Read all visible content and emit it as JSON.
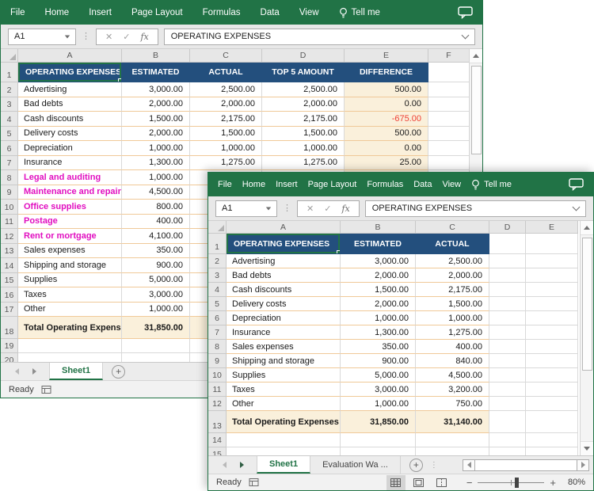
{
  "colors": {
    "ribbon_green": "#217346",
    "header_blue": "#234F7D",
    "total_beige": "#FAF0DB",
    "row_border_tan": "#F0C998",
    "removed_row_magenta": "#E10FC0",
    "negative_red": "#EF3E33",
    "selection_green": "#217346",
    "active_tab_green": "#217346"
  },
  "icons": {
    "tell_me": "lightbulb",
    "ribbon_right": "comment-bubble",
    "name_box_arrow": "chevron-down",
    "formula_buttons": [
      "cancel-x",
      "enter-check",
      "fx"
    ],
    "formula_bar_right": "chevron-down",
    "status_left": "macro-record",
    "view_modes": [
      "normal-grid-view",
      "page-layout-view",
      "page-break-view"
    ],
    "zoom_controls": [
      "minus",
      "slider",
      "plus"
    ]
  },
  "windows": [
    {
      "ribbon": {
        "menus": [
          "File",
          "Home",
          "Insert",
          "Page Layout",
          "Formulas",
          "Data",
          "View"
        ],
        "tell_me": "Tell me"
      },
      "name_box": "A1",
      "formula_bar": "OPERATING EXPENSES",
      "grid": {
        "columns": [
          "A",
          "B",
          "C",
          "D",
          "E",
          "F"
        ],
        "rows": [
          {
            "n": "1",
            "type": "header",
            "cells": [
              "OPERATING EXPENSES",
              "ESTIMATED",
              "ACTUAL",
              "TOP 5 AMOUNT",
              "DIFFERENCE",
              ""
            ]
          },
          {
            "n": "2",
            "type": "data",
            "cells": [
              "Advertising",
              "3,000.00",
              "2,500.00",
              "2,500.00",
              "500.00",
              ""
            ]
          },
          {
            "n": "3",
            "type": "data",
            "cells": [
              "Bad debts",
              "2,000.00",
              "2,000.00",
              "2,000.00",
              "0.00",
              ""
            ]
          },
          {
            "n": "4",
            "type": "data",
            "cells": [
              "Cash discounts",
              "1,500.00",
              "2,175.00",
              "2,175.00",
              "-675.00",
              ""
            ]
          },
          {
            "n": "5",
            "type": "data",
            "cells": [
              "Delivery costs",
              "2,000.00",
              "1,500.00",
              "1,500.00",
              "500.00",
              ""
            ]
          },
          {
            "n": "6",
            "type": "data",
            "cells": [
              "Depreciation",
              "1,000.00",
              "1,000.00",
              "1,000.00",
              "0.00",
              ""
            ]
          },
          {
            "n": "7",
            "type": "data",
            "cells": [
              "Insurance",
              "1,300.00",
              "1,275.00",
              "1,275.00",
              "25.00",
              ""
            ]
          },
          {
            "n": "8",
            "type": "data",
            "pink": true,
            "cells": [
              "Legal and auditing",
              "1,000.00",
              "",
              "",
              "",
              ""
            ]
          },
          {
            "n": "9",
            "type": "data",
            "pink": true,
            "cells": [
              "Maintenance and repairs",
              "4,500.00",
              "",
              "",
              "",
              ""
            ]
          },
          {
            "n": "10",
            "type": "data",
            "pink": true,
            "cells": [
              "Office supplies",
              "800.00",
              "",
              "",
              "",
              ""
            ]
          },
          {
            "n": "11",
            "type": "data",
            "pink": true,
            "cells": [
              "Postage",
              "400.00",
              "",
              "",
              "",
              ""
            ]
          },
          {
            "n": "12",
            "type": "data",
            "pink": true,
            "cells": [
              "Rent or mortgage",
              "4,100.00",
              "",
              "",
              "",
              ""
            ]
          },
          {
            "n": "13",
            "type": "data",
            "cells": [
              "Sales expenses",
              "350.00",
              "",
              "",
              "",
              ""
            ]
          },
          {
            "n": "14",
            "type": "data",
            "cells": [
              "Shipping and storage",
              "900.00",
              "",
              "",
              "",
              ""
            ]
          },
          {
            "n": "15",
            "type": "data",
            "cells": [
              "Supplies",
              "5,000.00",
              "",
              "",
              "",
              ""
            ]
          },
          {
            "n": "16",
            "type": "data",
            "cells": [
              "Taxes",
              "3,000.00",
              "",
              "",
              "",
              ""
            ]
          },
          {
            "n": "17",
            "type": "data",
            "cells": [
              "Other",
              "1,000.00",
              "",
              "",
              "",
              ""
            ]
          },
          {
            "n": "18",
            "type": "total",
            "cells": [
              "Total Operating Expenses",
              "31,850.00",
              "",
              "",
              "",
              ""
            ]
          },
          {
            "n": "19",
            "type": "empty",
            "cells": [
              "",
              "",
              "",
              "",
              "",
              ""
            ]
          },
          {
            "n": "20",
            "type": "empty",
            "cells": [
              "",
              "",
              "",
              "",
              "",
              ""
            ]
          }
        ]
      },
      "tabs": [
        {
          "label": "Sheet1",
          "active": true
        }
      ],
      "status": "Ready"
    },
    {
      "ribbon": {
        "menus": [
          "File",
          "Home",
          "Insert",
          "Page Layout",
          "Formulas",
          "Data",
          "View"
        ],
        "tell_me": "Tell me"
      },
      "name_box": "A1",
      "formula_bar": "OPERATING EXPENSES",
      "grid": {
        "columns": [
          "A",
          "B",
          "C",
          "D",
          "E"
        ],
        "rows": [
          {
            "n": "1",
            "type": "header",
            "cells": [
              "OPERATING EXPENSES",
              "ESTIMATED",
              "ACTUAL",
              "",
              ""
            ]
          },
          {
            "n": "2",
            "type": "data",
            "cells": [
              "Advertising",
              "3,000.00",
              "2,500.00",
              "",
              ""
            ]
          },
          {
            "n": "3",
            "type": "data",
            "cells": [
              "Bad debts",
              "2,000.00",
              "2,000.00",
              "",
              ""
            ]
          },
          {
            "n": "4",
            "type": "data",
            "cells": [
              "Cash discounts",
              "1,500.00",
              "2,175.00",
              "",
              ""
            ]
          },
          {
            "n": "5",
            "type": "data",
            "cells": [
              "Delivery costs",
              "2,000.00",
              "1,500.00",
              "",
              ""
            ]
          },
          {
            "n": "6",
            "type": "data",
            "cells": [
              "Depreciation",
              "1,000.00",
              "1,000.00",
              "",
              ""
            ]
          },
          {
            "n": "7",
            "type": "data",
            "cells": [
              "Insurance",
              "1,300.00",
              "1,275.00",
              "",
              ""
            ]
          },
          {
            "n": "8",
            "type": "data",
            "cells": [
              "Sales expenses",
              "350.00",
              "400.00",
              "",
              ""
            ]
          },
          {
            "n": "9",
            "type": "data",
            "cells": [
              "Shipping and storage",
              "900.00",
              "840.00",
              "",
              ""
            ]
          },
          {
            "n": "10",
            "type": "data",
            "cells": [
              "Supplies",
              "5,000.00",
              "4,500.00",
              "",
              ""
            ]
          },
          {
            "n": "11",
            "type": "data",
            "cells": [
              "Taxes",
              "3,000.00",
              "3,200.00",
              "",
              ""
            ]
          },
          {
            "n": "12",
            "type": "data",
            "cells": [
              "Other",
              "1,000.00",
              "750.00",
              "",
              ""
            ]
          },
          {
            "n": "13",
            "type": "total",
            "cells": [
              "Total Operating Expenses",
              "31,850.00",
              "31,140.00",
              "",
              ""
            ]
          },
          {
            "n": "14",
            "type": "empty",
            "cells": [
              "",
              "",
              "",
              "",
              ""
            ]
          },
          {
            "n": "15",
            "type": "empty",
            "cells": [
              "",
              "",
              "",
              "",
              ""
            ]
          }
        ]
      },
      "tabs": [
        {
          "label": "Sheet1",
          "active": true
        },
        {
          "label": "Evaluation Wa ...",
          "active": false
        }
      ],
      "status": "Ready",
      "zoom_level": "80%"
    }
  ]
}
